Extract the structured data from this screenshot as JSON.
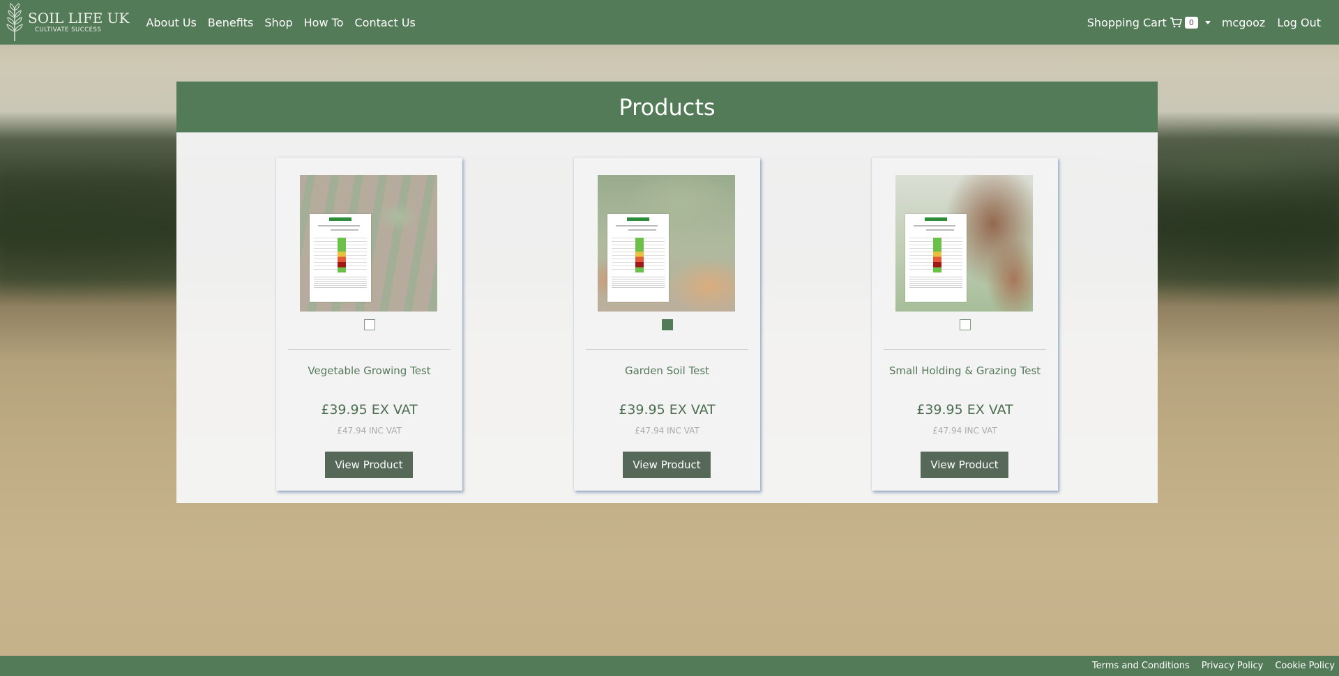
{
  "brand": {
    "name": "SOIL LIFE UK",
    "tagline": "CULTIVATE SUCCESS"
  },
  "nav": {
    "links": [
      "About Us",
      "Benefits",
      "Shop",
      "How To",
      "Contact Us"
    ],
    "cart_label": "Shopping Cart",
    "cart_count": "0",
    "cart_icon": "cart-icon",
    "username": "mcgooz",
    "logout": "Log Out"
  },
  "panel": {
    "title": "Products"
  },
  "products": [
    {
      "name": "Vegetable Growing Test",
      "price_ex": "£39.95 EX VAT",
      "price_inc": "£47.94 INC VAT",
      "button": "View Product",
      "selected": false
    },
    {
      "name": "Garden Soil Test",
      "price_ex": "£39.95 EX VAT",
      "price_inc": "£47.94 INC VAT",
      "button": "View Product",
      "selected": true
    },
    {
      "name": "Small Holding & Grazing Test",
      "price_ex": "£39.95 EX VAT",
      "price_inc": "£47.94 INC VAT",
      "button": "View Product",
      "selected": false
    }
  ],
  "footer": {
    "links": [
      "Terms and Conditions",
      "Privacy Policy",
      "Cookie Policy"
    ]
  },
  "colors": {
    "brand_green": "#547b58",
    "button_dark": "#566857",
    "product_text": "#55775a"
  }
}
